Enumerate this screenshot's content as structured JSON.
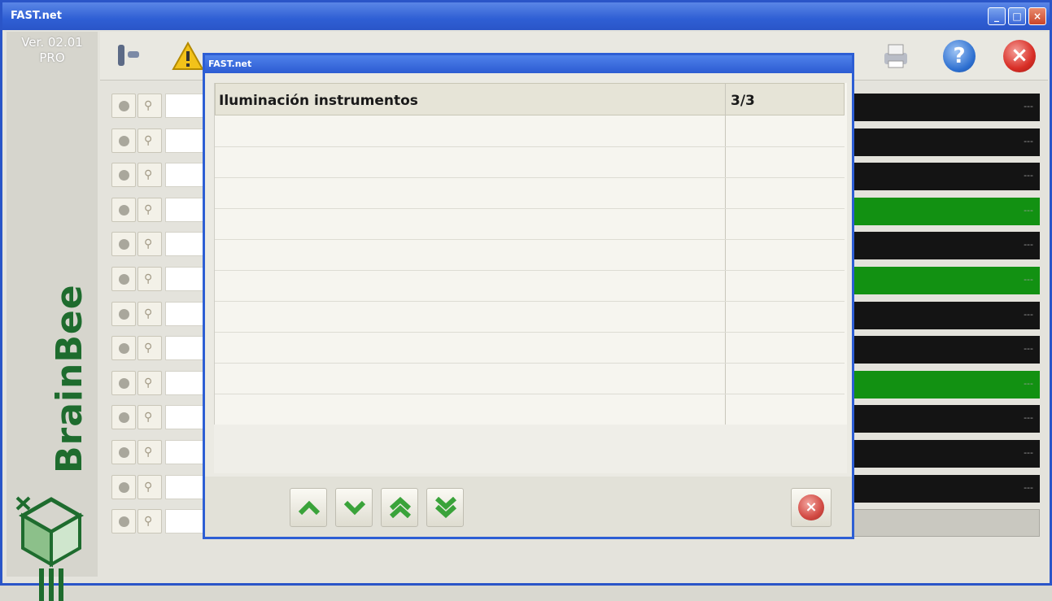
{
  "window": {
    "title": "FAST.net",
    "controls": [
      "minimize-icon",
      "maximize-icon",
      "close-icon"
    ]
  },
  "sidebar": {
    "version_line1": "Ver. 02.01",
    "version_line2": "PRO",
    "brand": "BrainBee"
  },
  "toolbar": {
    "icons": [
      "tools-icon",
      "warning-icon",
      "print-icon",
      "help-icon",
      "exit-icon"
    ]
  },
  "dialog": {
    "title": "FAST.net",
    "header": {
      "label": "Iluminación instrumentos",
      "page": "3/3"
    },
    "nav_buttons": [
      "line-up-icon",
      "line-down-icon",
      "page-up-icon",
      "page-down-icon"
    ],
    "close_icon": "close-icon",
    "close_symbol": "×"
  },
  "status_bars": {
    "states": [
      "off",
      "off",
      "off",
      "on",
      "off",
      "on",
      "off",
      "off",
      "on",
      "off",
      "off",
      "off",
      "empty"
    ],
    "value_text": "---",
    "colors": {
      "off": "#141414",
      "on": "#129112",
      "empty": "#c9c8c0"
    }
  },
  "colors": {
    "titlebar": "#2a55c8",
    "brand_green": "#1e6c2e",
    "nav_arrow_green": "#3aa33a",
    "close_red": "#d24a43"
  }
}
